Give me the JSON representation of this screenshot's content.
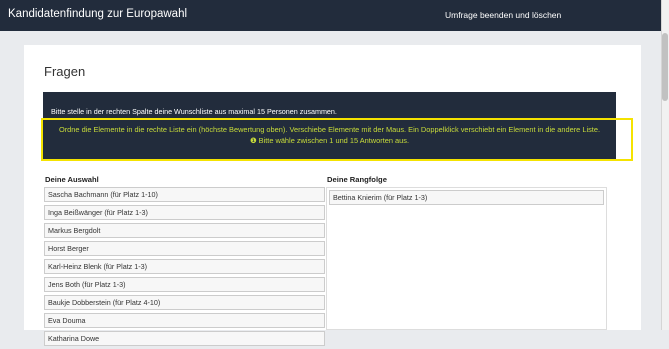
{
  "header": {
    "title": "Kandidatenfindung zur Europawahl",
    "action": "Umfrage beenden und löschen"
  },
  "page_title": "Fragen",
  "banner": {
    "intro": "Bitte stelle in der rechten Spalte deine Wunschliste aus maximal 15 Personen zusammen.",
    "instruction": "Ordne die Elemente in die rechte Liste ein (höchste Bewertung oben). Verschiebe Elemente mit der Maus. Ein Doppelklick verschiebt ein Element in die andere Liste.",
    "hint": "❶ Bitte wähle zwischen 1 und 15 Antworten aus."
  },
  "left_list": {
    "title": "Deine Auswahl",
    "items": [
      "Sascha Bachmann (für Platz 1-10)",
      "Inga Beißwänger (für Platz 1-3)",
      "Markus Bergdolt",
      "Horst Berger",
      "Karl-Heinz Blenk (für Platz 1-3)",
      "Jens Both (für Platz 1-3)",
      "Baukje Dobberstein (für Platz 4-10)",
      "Eva Douma",
      "Katharina Dowe"
    ]
  },
  "right_list": {
    "title": "Deine Rangfolge",
    "items": [
      "Bettina Knierim (für Platz 1-3)"
    ]
  }
}
